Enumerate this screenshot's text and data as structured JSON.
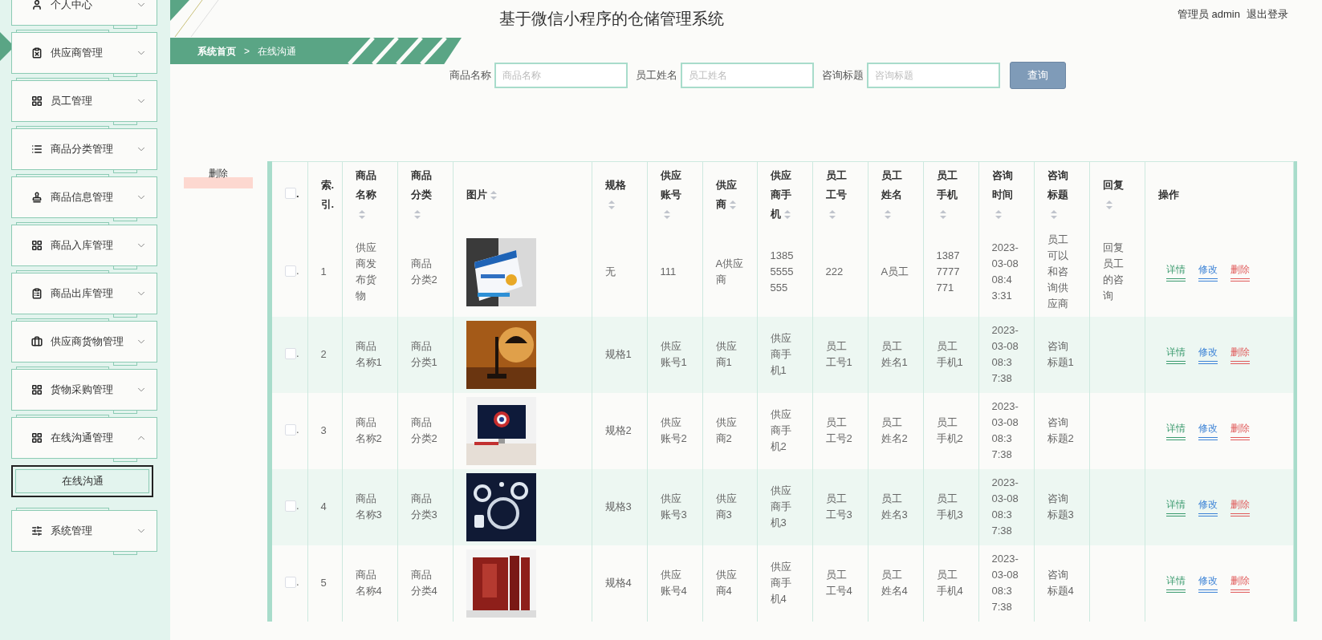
{
  "sidebar": {
    "items": [
      {
        "label": "个人中心",
        "expanded": false
      },
      {
        "label": "供应商管理",
        "expanded": false
      },
      {
        "label": "员工管理",
        "expanded": false
      },
      {
        "label": "商品分类管理",
        "expanded": false
      },
      {
        "label": "商品信息管理",
        "expanded": false
      },
      {
        "label": "商品入库管理",
        "expanded": false
      },
      {
        "label": "商品出库管理",
        "expanded": false
      },
      {
        "label": "供应商货物管理",
        "expanded": false
      },
      {
        "label": "货物采购管理",
        "expanded": false
      },
      {
        "label": "在线沟通管理",
        "expanded": true,
        "children": [
          {
            "label": "在线沟通",
            "selected": true
          }
        ]
      },
      {
        "label": "系统管理",
        "expanded": false
      }
    ]
  },
  "header": {
    "title": "基于微信小程序的仓储管理系统",
    "user": "管理员 admin",
    "logout": "退出登录"
  },
  "breadcrumb": {
    "home": "系统首页",
    "separator": ">",
    "current": "在线沟通"
  },
  "search": {
    "fields": [
      {
        "label": "商品名称",
        "placeholder": "商品名称"
      },
      {
        "label": "员工姓名",
        "placeholder": "员工姓名"
      },
      {
        "label": "咨询标题",
        "placeholder": "咨询标题"
      }
    ],
    "button": "查询"
  },
  "delete_button": "删除",
  "table": {
    "select_all": {
      "checked": false,
      "suffix": "."
    },
    "columns": [
      {
        "label": "索.引.",
        "kind": "text",
        "sortable": false
      },
      {
        "label": "商品名称",
        "kind": "text",
        "sortable": true
      },
      {
        "label": "商品分类",
        "kind": "text",
        "sortable": true
      },
      {
        "label": "图片",
        "kind": "picture",
        "sortable": true
      },
      {
        "label": "规格",
        "kind": "text",
        "sortable": true
      },
      {
        "label": "供应账号",
        "kind": "text",
        "sortable": true
      },
      {
        "label": "供应商",
        "kind": "text",
        "sortable": true
      },
      {
        "label": "供应商手机",
        "kind": "text",
        "sortable": true
      },
      {
        "label": "员工工号",
        "kind": "text",
        "sortable": true
      },
      {
        "label": "员工姓名",
        "kind": "text",
        "sortable": true
      },
      {
        "label": "员工手机",
        "kind": "text",
        "sortable": true
      },
      {
        "label": "咨询时间",
        "kind": "text",
        "sortable": true
      },
      {
        "label": "咨询标题",
        "kind": "text",
        "sortable": true
      },
      {
        "label": "回复",
        "kind": "text",
        "sortable": true
      },
      {
        "label": "操作",
        "kind": "actions",
        "sortable": false
      }
    ],
    "rows": [
      {
        "checked": false,
        "suffix": ".",
        "cells": [
          "1",
          "供应商发布货物",
          "商品分类2",
          {
            "kind": "picture"
          },
          "无",
          "111",
          "A供应商",
          "13855555555",
          "222",
          "A员工",
          "13877777771",
          "2023-03-08 08:43:31",
          "员工可以和咨询供应商",
          "回复员工的咨询",
          [
            {
              "label": "详情",
              "kind": "detail"
            },
            {
              "label": "修改",
              "kind": "edit"
            },
            {
              "label": "删除",
              "kind": "delete"
            }
          ]
        ]
      },
      {
        "checked": false,
        "suffix": ".",
        "cells": [
          "2",
          "商品名称1",
          "商品分类1",
          {
            "kind": "picture"
          },
          "规格1",
          "供应账号1",
          "供应商1",
          "供应商手机1",
          "员工工号1",
          "员工姓名1",
          "员工手机1",
          "2023-03-08 08:37:38",
          "咨询标题1",
          null,
          [
            {
              "label": "详情",
              "kind": "detail"
            },
            {
              "label": "修改",
              "kind": "edit"
            },
            {
              "label": "删除",
              "kind": "delete"
            }
          ]
        ]
      },
      {
        "checked": false,
        "suffix": ".",
        "cells": [
          "3",
          "商品名称2",
          "商品分类2",
          {
            "kind": "picture"
          },
          "规格2",
          "供应账号2",
          "供应商2",
          "供应商手机2",
          "员工工号2",
          "员工姓名2",
          "员工手机2",
          "2023-03-08 08:37:38",
          "咨询标题2",
          null,
          [
            {
              "label": "详情",
              "kind": "detail"
            },
            {
              "label": "修改",
              "kind": "edit"
            },
            {
              "label": "删除",
              "kind": "delete"
            }
          ]
        ]
      },
      {
        "checked": false,
        "suffix": ".",
        "cells": [
          "4",
          "商品名称3",
          "商品分类3",
          {
            "kind": "picture"
          },
          "规格3",
          "供应账号3",
          "供应商3",
          "供应商手机3",
          "员工工号3",
          "员工姓名3",
          "员工手机3",
          "2023-03-08 08:37:38",
          "咨询标题3",
          null,
          [
            {
              "label": "详情",
              "kind": "detail"
            },
            {
              "label": "修改",
              "kind": "edit"
            },
            {
              "label": "删除",
              "kind": "delete"
            }
          ]
        ]
      },
      {
        "checked": false,
        "suffix": ".",
        "cells": [
          "5",
          "商品名称4",
          "商品分类4",
          {
            "kind": "picture"
          },
          "规格4",
          "供应账号4",
          "供应商4",
          "供应商手机4",
          "员工工号4",
          "员工姓名4",
          "员工手机4",
          "2023-03-08 08:37:38",
          "咨询标题4",
          null,
          [
            {
              "label": "详情",
              "kind": "detail"
            },
            {
              "label": "修改",
              "kind": "edit"
            },
            {
              "label": "删除",
              "kind": "delete"
            }
          ]
        ]
      }
    ]
  }
}
